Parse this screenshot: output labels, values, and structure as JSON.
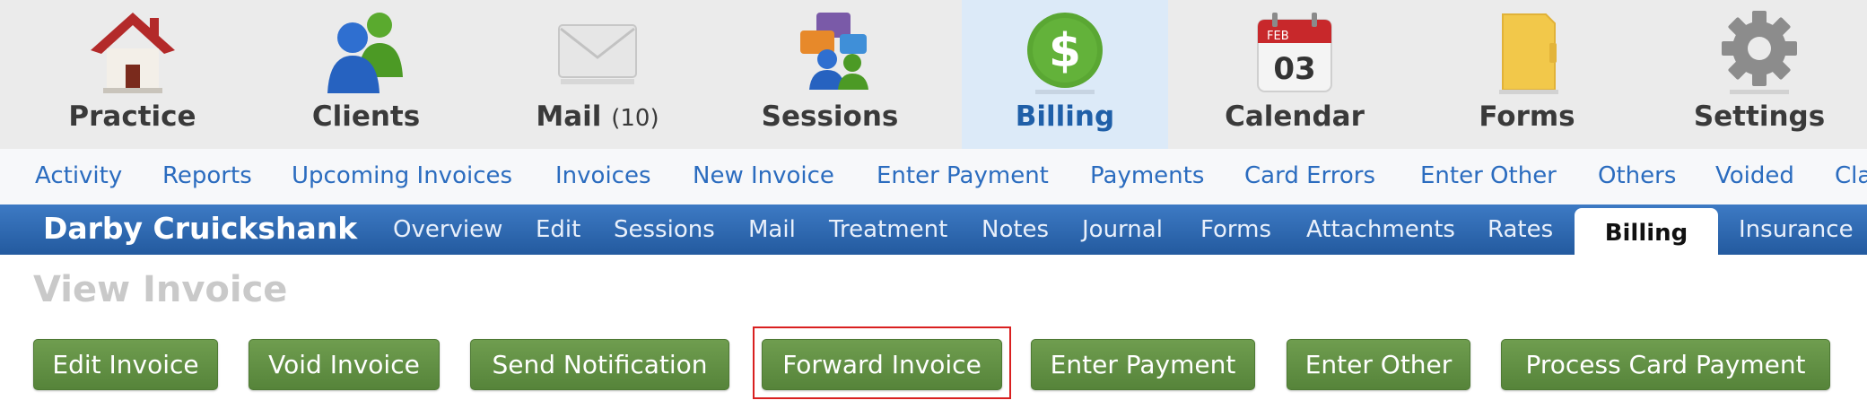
{
  "topnav": {
    "items": [
      {
        "label": "Practice",
        "icon": "house-icon"
      },
      {
        "label": "Clients",
        "icon": "people-icon"
      },
      {
        "label": "Mail",
        "count": "(10)",
        "icon": "envelope-icon"
      },
      {
        "label": "Sessions",
        "icon": "chat-bubbles-icon"
      },
      {
        "label": "Billing",
        "icon": "dollar-sign-icon",
        "active": true
      },
      {
        "label": "Calendar",
        "icon": "calendar-icon"
      },
      {
        "label": "Forms",
        "icon": "folder-icon"
      },
      {
        "label": "Settings",
        "icon": "gear-icon"
      }
    ],
    "calendar": {
      "month": "FEB",
      "day": "03"
    },
    "billing_symbol": "$"
  },
  "subnav": {
    "links": [
      "Activity",
      "Reports",
      "Upcoming Invoices",
      "Invoices",
      "New Invoice",
      "Enter Payment",
      "Payments",
      "Card Errors",
      "Enter Other",
      "Others",
      "Voided",
      "Cla"
    ]
  },
  "client": {
    "name": "Darby Cruickshank",
    "tabs": [
      "Overview",
      "Edit",
      "Sessions",
      "Mail",
      "Treatment",
      "Notes",
      "Journal",
      "Forms",
      "Attachments",
      "Rates",
      "Billing",
      "Insurance"
    ],
    "active_tab": "Billing"
  },
  "page": {
    "title": "View Invoice"
  },
  "actions": {
    "buttons": [
      "Edit Invoice",
      "Void Invoice",
      "Send Notification",
      "Forward Invoice",
      "Enter Payment",
      "Enter Other",
      "Process Card Payment"
    ],
    "highlighted": "Forward Invoice"
  },
  "colors": {
    "accent_blue": "#2b6cbf",
    "client_bar": "#2f68b0",
    "button_green": "#5f8f43",
    "highlight_red": "#d92020",
    "active_nav_bg": "#dceaf8"
  }
}
